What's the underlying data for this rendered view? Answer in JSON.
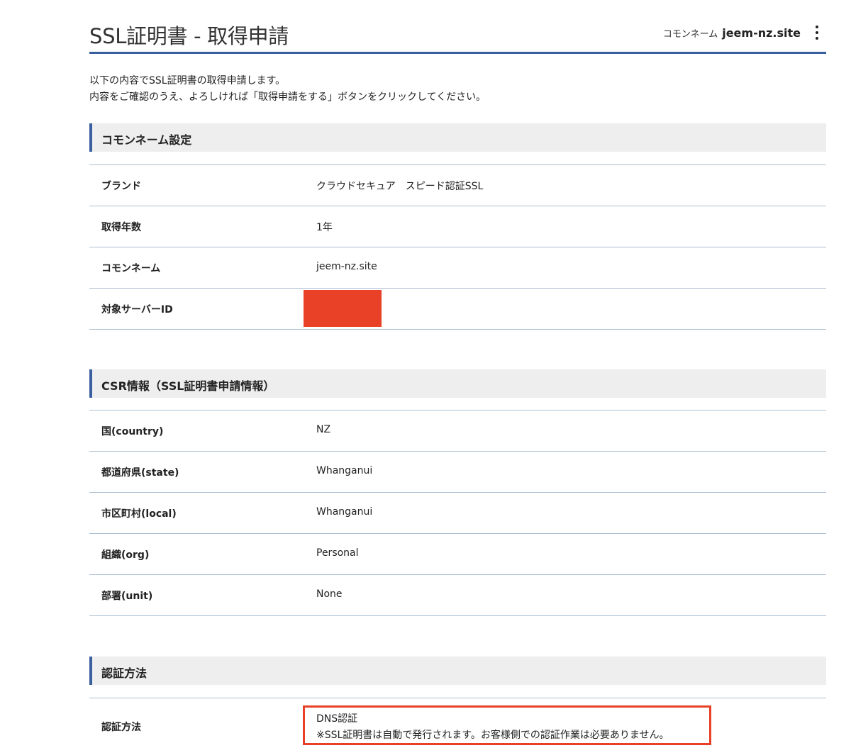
{
  "header": {
    "title": "SSL証明書 - 取得申請",
    "common_name_label": "コモンネーム",
    "common_name_value": "jeem-nz.site"
  },
  "intro": {
    "line1": "以下の内容でSSL証明書の取得申請します。",
    "line2": "内容をご確認のうえ、よろしければ「取得申請をする」ボタンをクリックしてください。"
  },
  "sections": {
    "common_name": {
      "title": "コモンネーム設定",
      "rows": [
        {
          "label": "ブランド",
          "value": "クラウドセキュア　スピード認証SSL"
        },
        {
          "label": "取得年数",
          "value": "1年"
        },
        {
          "label": "コモンネーム",
          "value": "jeem-nz.site"
        },
        {
          "label": "対象サーバーID",
          "value": ""
        }
      ]
    },
    "csr": {
      "title": "CSR情報（SSL証明書申請情報）",
      "rows": [
        {
          "label": "国(country)",
          "value": "NZ"
        },
        {
          "label": "都道府県(state)",
          "value": "Whanganui"
        },
        {
          "label": "市区町村(local)",
          "value": "Whanganui"
        },
        {
          "label": "組織(org)",
          "value": "Personal"
        },
        {
          "label": "部署(unit)",
          "value": "None"
        }
      ]
    },
    "auth": {
      "title": "認証方法",
      "label": "認証方法",
      "value": "DNS認証",
      "note": "※SSL証明書は自動で発行されます。お客様側での認証作業は必要ありません。"
    }
  },
  "colors": {
    "accent": "#3a5f9f",
    "highlight": "#e84128",
    "section_bg": "#eeeeee",
    "row_border": "#a9bfd3"
  },
  "icons": {
    "menu": "kebab-menu-icon"
  }
}
